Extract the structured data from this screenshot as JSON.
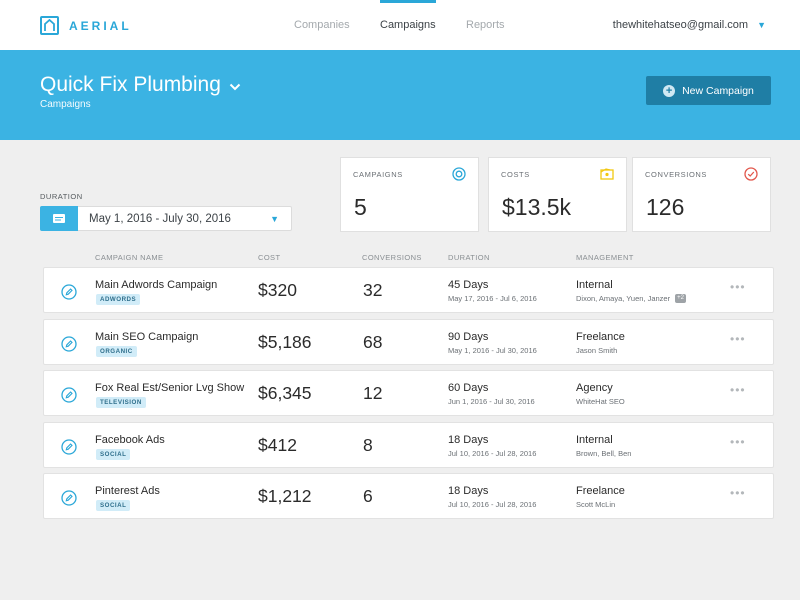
{
  "brand": {
    "name": "AERIAL"
  },
  "nav": {
    "tabs": [
      "Companies",
      "Campaigns",
      "Reports"
    ],
    "active": "Campaigns"
  },
  "user": {
    "email": "thewhitehatseo@gmail.com"
  },
  "header": {
    "title": "Quick Fix Plumbing",
    "subtitle": "Campaigns",
    "new_button": "New Campaign"
  },
  "filter": {
    "label": "DURATION",
    "value": "May 1, 2016 - July 30, 2016"
  },
  "stats": [
    {
      "label": "CAMPAIGNS",
      "value": "5",
      "icon": "target-icon"
    },
    {
      "label": "COSTS",
      "value": "$13.5k",
      "icon": "money-icon"
    },
    {
      "label": "CONVERSIONS",
      "value": "126",
      "icon": "check-circle-icon"
    }
  ],
  "table": {
    "headers": [
      "CAMPAIGN NAME",
      "COST",
      "CONVERSIONS",
      "DURATION",
      "MANAGEMENT"
    ],
    "rows": [
      {
        "name": "Main Adwords Campaign",
        "tag": "ADWORDS",
        "cost": "$320",
        "conversions": "32",
        "duration": "45 Days",
        "dates": "May 17, 2016 - Jul 6, 2016",
        "management": "Internal",
        "people": "Dixon, Amaya, Yuen, Janzer",
        "extra": "+2"
      },
      {
        "name": "Main SEO Campaign",
        "tag": "ORGANIC",
        "cost": "$5,186",
        "conversions": "68",
        "duration": "90 Days",
        "dates": "May 1, 2016 - Jul 30, 2016",
        "management": "Freelance",
        "people": "Jason Smith"
      },
      {
        "name": "Fox Real Est/Senior Lvg Show",
        "tag": "TELEVISION",
        "cost": "$6,345",
        "conversions": "12",
        "duration": "60 Days",
        "dates": "Jun 1, 2016 - Jul 30, 2016",
        "management": "Agency",
        "people": "WhiteHat SEO"
      },
      {
        "name": "Facebook Ads",
        "tag": "SOCIAL",
        "cost": "$412",
        "conversions": "8",
        "duration": "18 Days",
        "dates": "Jul 10, 2016 - Jul 28, 2016",
        "management": "Internal",
        "people": "Brown, Bell, Ben"
      },
      {
        "name": "Pinterest Ads",
        "tag": "SOCIAL",
        "cost": "$1,212",
        "conversions": "6",
        "duration": "18 Days",
        "dates": "Jul 10, 2016 - Jul 28, 2016",
        "management": "Freelance",
        "people": "Scott McLin"
      }
    ]
  },
  "colors": {
    "accent": "#3bb3e3",
    "button": "#1f7ea5",
    "costs_icon": "#f2c811",
    "conversions_icon": "#e2574c"
  }
}
